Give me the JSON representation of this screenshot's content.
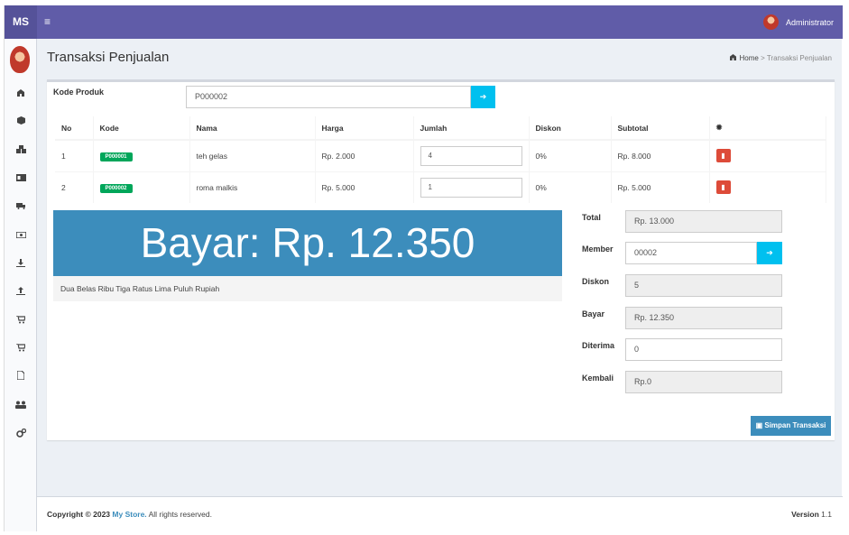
{
  "app": {
    "logo": "MS",
    "menu_icon": "≡",
    "user_name": "Administrator"
  },
  "sidebar": {
    "icons": [
      "dashboard-icon",
      "cube-icon",
      "cubes-icon",
      "id-card-icon",
      "truck-icon",
      "money-icon",
      "download-icon",
      "upload-icon",
      "cart-icon",
      "cart-icon",
      "file-icon",
      "users-icon",
      "cogs-icon"
    ]
  },
  "page": {
    "title": "Transaksi Penjualan"
  },
  "breadcrumb": {
    "home": "Home",
    "sep": ">",
    "current": "Transaksi Penjualan"
  },
  "form": {
    "kode_label": "Kode Produk",
    "kode_value": "P000002"
  },
  "table": {
    "headers": [
      "No",
      "Kode",
      "Nama",
      "Harga",
      "Jumlah",
      "Diskon",
      "Subtotal"
    ],
    "rows": [
      {
        "no": "1",
        "kode": "P000001",
        "nama": "teh gelas",
        "harga": "Rp. 2.000",
        "jumlah": "4",
        "diskon": "0%",
        "subtotal": "Rp. 8.000"
      },
      {
        "no": "2",
        "kode": "P000002",
        "nama": "roma malkis",
        "harga": "Rp. 5.000",
        "jumlah": "1",
        "diskon": "0%",
        "subtotal": "Rp. 5.000"
      }
    ]
  },
  "summary": {
    "bayar_display": "Bayar: Rp. 12.350",
    "terbilang": "Dua Belas Ribu Tiga Ratus Lima Puluh Rupiah",
    "total_label": "Total",
    "total_value": "Rp. 13.000",
    "member_label": "Member",
    "member_value": "00002",
    "diskon_label": "Diskon",
    "diskon_value": "5",
    "bayar_label": "Bayar",
    "bayar_value": "Rp. 12.350",
    "diterima_label": "Diterima",
    "diterima_value": "0",
    "kembali_label": "Kembali",
    "kembali_value": "Rp.0",
    "save_label": "Simpan Transaksi"
  },
  "footer": {
    "copyright_prefix": "Copyright © 2023",
    "brand": "My Store.",
    "rights": "All rights reserved.",
    "version_label": "Version",
    "version_value": "1.1"
  }
}
